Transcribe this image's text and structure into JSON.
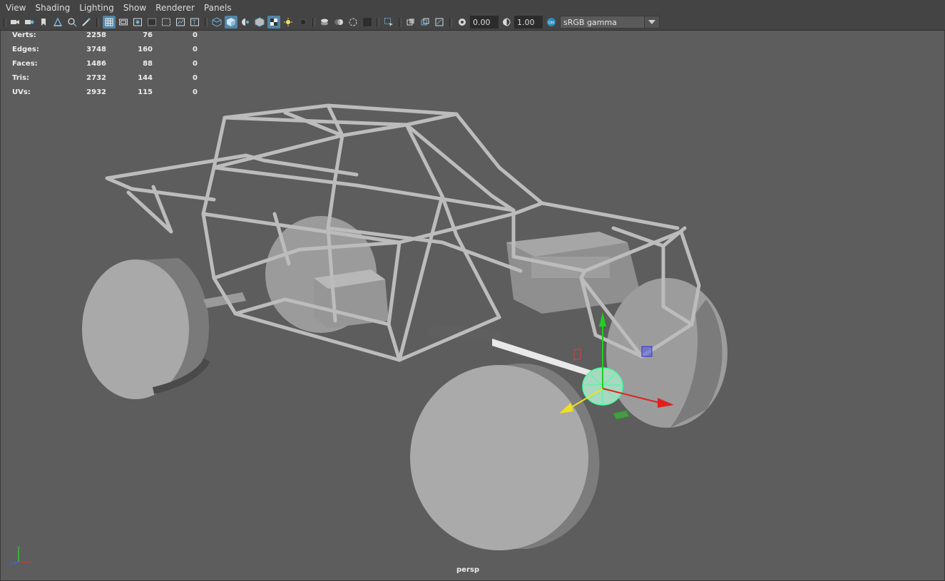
{
  "menu": {
    "items": [
      "View",
      "Shading",
      "Lighting",
      "Show",
      "Renderer",
      "Panels"
    ]
  },
  "toolbar": {
    "exposure": "0.00",
    "gamma": "1.00",
    "colorspace": "sRGB gamma",
    "icons": [
      "camera-icon",
      "camera-attributes-icon",
      "bookmark-icon",
      "image-plane-icon",
      "2d-pan-zoom-icon",
      "grease-pencil-icon",
      "grid-icon",
      "film-gate-icon",
      "resolution-gate-icon",
      "gate-mask-icon",
      "field-chart-icon",
      "safe-action-icon",
      "wireframe-icon",
      "smooth-shade-icon",
      "shade-selected-icon",
      "wireframe-on-shaded-icon",
      "textured-icon",
      "use-all-lights-icon",
      "shadows-icon",
      "screen-space-ao-icon",
      "motion-blur-icon",
      "anti-aliasing-icon",
      "depth-of-field-icon",
      "isolate-select-icon",
      "xray-icon",
      "xray-active-icon",
      "xray-joints-icon",
      "exposure-icon",
      "gamma-icon",
      "color-management-icon"
    ]
  },
  "hud": {
    "rows": [
      {
        "label": "Verts:",
        "a": "2258",
        "b": "76",
        "c": "0"
      },
      {
        "label": "Edges:",
        "a": "3748",
        "b": "160",
        "c": "0"
      },
      {
        "label": "Faces:",
        "a": "1486",
        "b": "88",
        "c": "0"
      },
      {
        "label": "Tris:",
        "a": "2732",
        "b": "144",
        "c": "0"
      },
      {
        "label": "UVs:",
        "a": "2932",
        "b": "115",
        "c": "0"
      }
    ]
  },
  "viewport": {
    "camera": "persp",
    "axis_labels": {
      "y": "y",
      "x": "x",
      "z": "z"
    },
    "colors": {
      "background": "#5d5d5d",
      "mesh": "#a8a8a8",
      "manip_x": "#e02020",
      "manip_y": "#20d020",
      "manip_z": "#3030e0",
      "selection": "#40ffa0"
    }
  }
}
